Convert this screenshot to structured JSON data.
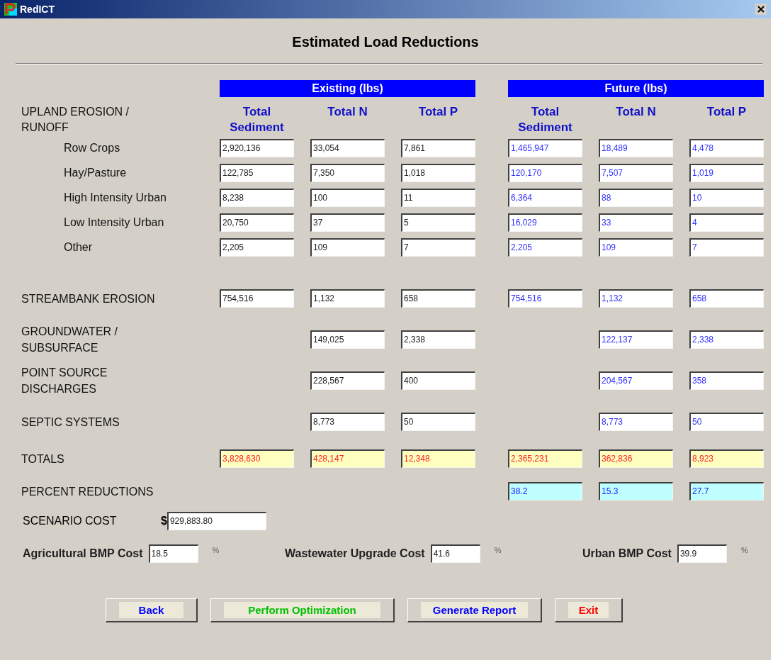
{
  "window": {
    "title": "RedICT"
  },
  "heading": "Estimated Load Reductions",
  "groups": [
    {
      "title": "Existing (lbs)"
    },
    {
      "title": "Future (lbs)"
    }
  ],
  "column_header": {
    "label": "UPLAND EROSION /\nRUNOFF",
    "columns": [
      "Total\nSediment",
      "Total N",
      "Total P",
      "Total\nSediment",
      "Total N",
      "Total P"
    ]
  },
  "rows": [
    {
      "label": "Row Crops",
      "kind": "sub",
      "existing": {
        "sediment": "2,920,136",
        "n": "33,054",
        "p": "7,861"
      },
      "future": {
        "sediment": "1,465,947",
        "n": "18,489",
        "p": "4,478"
      }
    },
    {
      "label": "Hay/Pasture",
      "kind": "sub",
      "existing": {
        "sediment": "122,785",
        "n": "7,350",
        "p": "1,018"
      },
      "future": {
        "sediment": "120,170",
        "n": "7,507",
        "p": "1,019"
      }
    },
    {
      "label": "High Intensity Urban",
      "kind": "sub",
      "existing": {
        "sediment": "8,238",
        "n": "100",
        "p": "11"
      },
      "future": {
        "sediment": "6,364",
        "n": "88",
        "p": "10"
      }
    },
    {
      "label": "Low Intensity Urban",
      "kind": "sub",
      "existing": {
        "sediment": "20,750",
        "n": "37",
        "p": "5"
      },
      "future": {
        "sediment": "16,029",
        "n": "33",
        "p": "4"
      }
    },
    {
      "label": "Other",
      "kind": "sub",
      "existing": {
        "sediment": "2,205",
        "n": "109",
        "p": "7"
      },
      "future": {
        "sediment": "2,205",
        "n": "109",
        "p": "7"
      }
    },
    {
      "label": "STREAMBANK EROSION",
      "kind": "main",
      "existing": {
        "sediment": "754,516",
        "n": "1,132",
        "p": "658"
      },
      "future": {
        "sediment": "754,516",
        "n": "1,132",
        "p": "658"
      }
    },
    {
      "label": "GROUNDWATER /\nSUBSURFACE",
      "kind": "main",
      "existing": {
        "n": "149,025",
        "p": "2,338"
      },
      "future": {
        "n": "122,137",
        "p": "2,338"
      }
    },
    {
      "label": "POINT SOURCE\nDISCHARGES",
      "kind": "main",
      "existing": {
        "n": "228,567",
        "p": "400"
      },
      "future": {
        "n": "204,567",
        "p": "358"
      }
    },
    {
      "label": "SEPTIC SYSTEMS",
      "kind": "main",
      "existing": {
        "n": "8,773",
        "p": "50"
      },
      "future": {
        "n": "8,773",
        "p": "50"
      }
    },
    {
      "label": "TOTALS",
      "kind": "totals",
      "existing": {
        "sediment": "3,828,630",
        "n": "428,147",
        "p": "12,348"
      },
      "future": {
        "sediment": "2,365,231",
        "n": "362,836",
        "p": "8,923"
      }
    },
    {
      "label": "PERCENT REDUCTIONS",
      "kind": "percent",
      "future": {
        "sediment": "38.2",
        "n": "15.3",
        "p": "27.7"
      }
    }
  ],
  "scenario_cost": {
    "label": "SCENARIO COST",
    "currency": "$",
    "value": "929,883.80"
  },
  "cost_shares": [
    {
      "label": "Agricultural BMP Cost",
      "value": "18.5",
      "unit": "%"
    },
    {
      "label": "Wastewater Upgrade Cost",
      "value": "41.6",
      "unit": "%"
    },
    {
      "label": "Urban BMP Cost",
      "value": "39.9",
      "unit": "%"
    }
  ],
  "buttons": [
    {
      "label": "Back",
      "color": "#0000ff"
    },
    {
      "label": "Perform Optimization",
      "color": "#00c000"
    },
    {
      "label": "Generate Report",
      "color": "#0000ff"
    },
    {
      "label": "Exit",
      "color": "#ff0000"
    }
  ]
}
